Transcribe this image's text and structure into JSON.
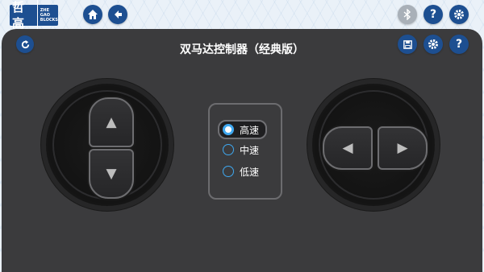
{
  "app": {
    "logo_text": "哲高",
    "logo_sub": "ZHE GAO BLOCKS"
  },
  "top_bar": {
    "left_icons": [
      "home-icon",
      "back-arrow-icon"
    ],
    "right_icons": [
      "bluetooth-icon",
      "help-icon",
      "settings-icon"
    ]
  },
  "panel": {
    "title": "双马达控制器（经典版）",
    "icons": [
      "refresh-icon",
      "save-icon",
      "settings-icon",
      "help-icon"
    ]
  },
  "left_pad": {
    "buttons": [
      {
        "name": "up",
        "glyph": "▲"
      },
      {
        "name": "down",
        "glyph": "▼"
      }
    ]
  },
  "right_pad": {
    "buttons": [
      {
        "name": "left",
        "glyph": "◀"
      },
      {
        "name": "right",
        "glyph": "▶"
      }
    ]
  },
  "speed": {
    "options": [
      "高速",
      "中速",
      "低速"
    ],
    "selected": "高速"
  },
  "colors": {
    "brand_blue": "#1d4f91",
    "panel_bg": "#3b3b3d",
    "radio_accent": "#3fa8f0",
    "disabled_grey": "#a9b0b8"
  }
}
